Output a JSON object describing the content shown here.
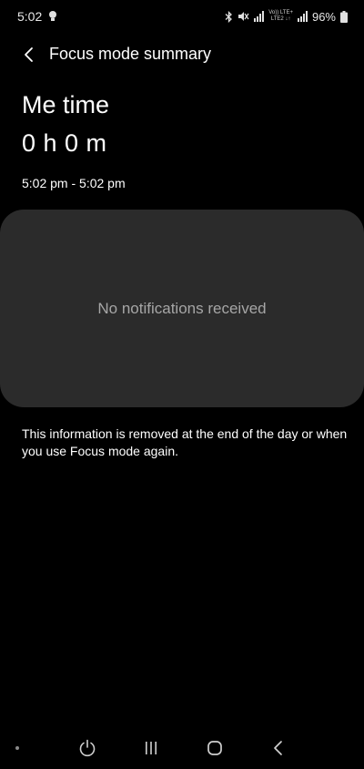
{
  "status_bar": {
    "time": "5:02",
    "volte_top": "Vo)) LTE+",
    "volte_bottom": "LTE2 ↓↑",
    "battery": "96%"
  },
  "header": {
    "title": "Focus mode summary"
  },
  "summary": {
    "mode_name": "Me time",
    "duration": "0 h 0 m",
    "time_range": "5:02 pm - 5:02 pm"
  },
  "notifications": {
    "empty_text": "No notifications received"
  },
  "info": {
    "text": "This information is removed at the end of the day or when you use Focus mode again."
  },
  "icons": {
    "status_left": "lightbulb-icon",
    "back": "back-arrow-icon",
    "nav_power": "power-icon",
    "nav_recents": "recents-icon",
    "nav_home": "home-icon",
    "nav_back": "nav-back-icon"
  },
  "colors": {
    "background": "#000000",
    "card": "#2b2b2b",
    "muted_text": "#a6a6a6"
  }
}
